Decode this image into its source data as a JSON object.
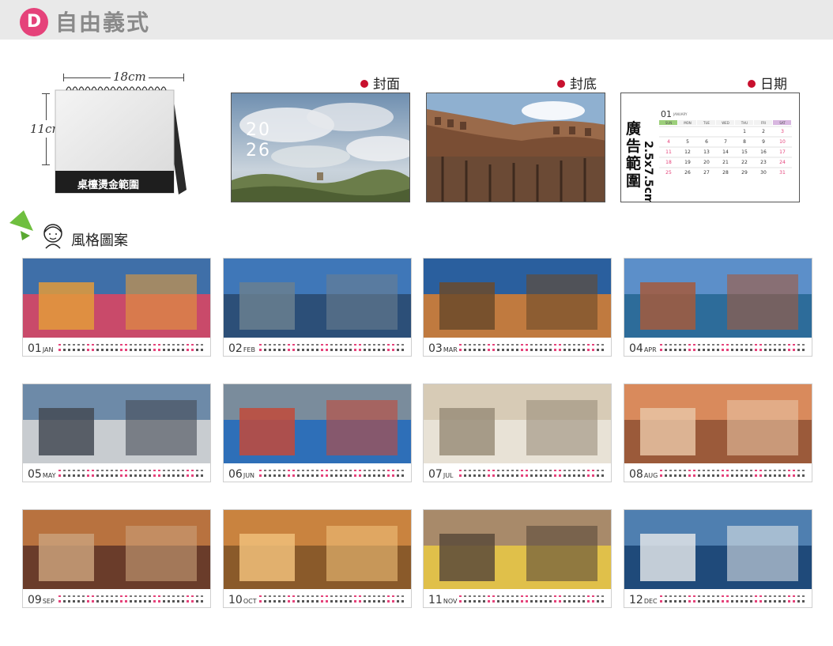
{
  "header": {
    "badge": "D",
    "title": "自由義式"
  },
  "desk": {
    "width_label": "18cm",
    "height_label": "11cm",
    "base_text": "桌檯燙金範圍"
  },
  "labels": {
    "cover": "封面",
    "back": "封底",
    "date": "日期"
  },
  "cover": {
    "year_line1": "20",
    "year_line2": "26"
  },
  "date_page": {
    "month_num": "01",
    "month_name": "JANUARY",
    "ad_text": "廣告範圍",
    "ad_size": "2.5x7.5cm",
    "weekdays": [
      "SUN",
      "MON",
      "TUE",
      "WED",
      "THU",
      "FRI",
      "SAT"
    ],
    "weeks": [
      [
        "",
        "",
        "",
        "",
        "1",
        "2",
        "3"
      ],
      [
        "4",
        "5",
        "6",
        "7",
        "8",
        "9",
        "10"
      ],
      [
        "11",
        "12",
        "13",
        "14",
        "15",
        "16",
        "17"
      ],
      [
        "18",
        "19",
        "20",
        "21",
        "22",
        "23",
        "24"
      ],
      [
        "25",
        "26",
        "27",
        "28",
        "29",
        "30",
        "31"
      ]
    ]
  },
  "style_section": {
    "title": "風格圖案"
  },
  "months": [
    {
      "num": "01",
      "name": "JAN"
    },
    {
      "num": "02",
      "name": "FEB"
    },
    {
      "num": "03",
      "name": "MAR"
    },
    {
      "num": "04",
      "name": "APR"
    },
    {
      "num": "05",
      "name": "MAY"
    },
    {
      "num": "06",
      "name": "JUN"
    },
    {
      "num": "07",
      "name": "JUL"
    },
    {
      "num": "08",
      "name": "AUG"
    },
    {
      "num": "09",
      "name": "SEP"
    },
    {
      "num": "10",
      "name": "OCT"
    },
    {
      "num": "11",
      "name": "NOV"
    },
    {
      "num": "12",
      "name": "DEC"
    }
  ],
  "colors": {
    "accent": "#e5427a",
    "red_dot": "#c8102e",
    "sunday": "#e5427a"
  }
}
